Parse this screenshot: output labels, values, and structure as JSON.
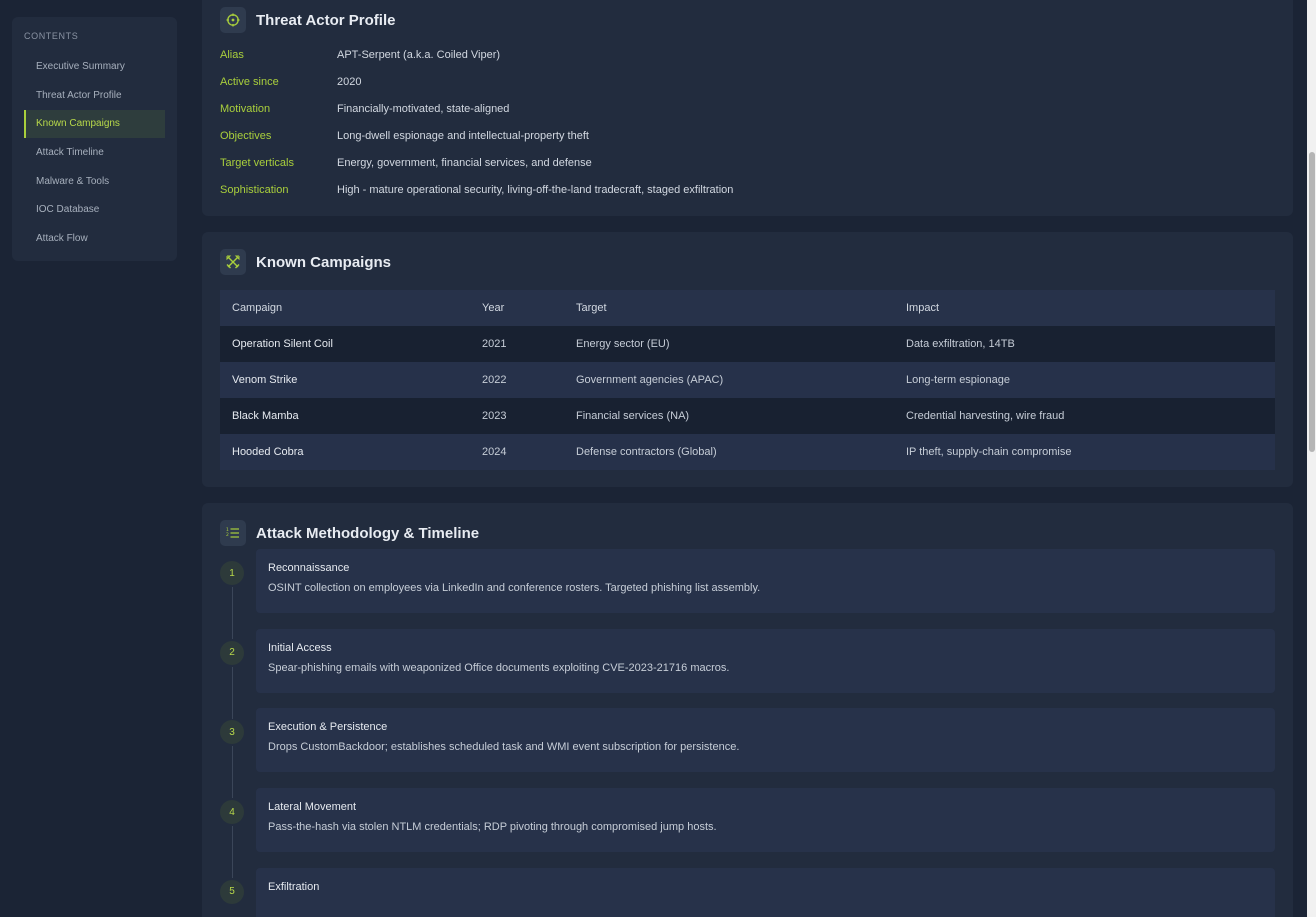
{
  "toc": {
    "heading": "CONTENTS",
    "items": [
      {
        "label": "Executive Summary"
      },
      {
        "label": "Threat Actor Profile"
      },
      {
        "label": "Known Campaigns",
        "active": true
      },
      {
        "label": "Attack Timeline"
      },
      {
        "label": "Malware & Tools"
      },
      {
        "label": "IOC Database"
      },
      {
        "label": "Attack Flow"
      }
    ]
  },
  "profile": {
    "title": "Threat Actor Profile",
    "icon": "crosshair-icon",
    "rows": [
      {
        "key": "Alias",
        "value": "APT-Serpent (a.k.a. Coiled Viper)"
      },
      {
        "key": "Active since",
        "value": "2020"
      },
      {
        "key": "Motivation",
        "value": "Financially-motivated, state-aligned"
      },
      {
        "key": "Objectives",
        "value": "Long-dwell espionage and intellectual-property theft"
      },
      {
        "key": "Target verticals",
        "value": "Energy, government, financial services, and defense"
      },
      {
        "key": "Sophistication",
        "value": "High - mature operational security, living-off-the-land tradecraft, staged exfiltration"
      }
    ]
  },
  "campaigns": {
    "title": "Known Campaigns",
    "icon": "crossed-swords-icon",
    "columns": [
      "Campaign",
      "Year",
      "Target",
      "Impact"
    ],
    "rows": [
      [
        "Operation Silent Coil",
        "2021",
        "Energy sector (EU)",
        "Data exfiltration, 14TB"
      ],
      [
        "Venom Strike",
        "2022",
        "Government agencies (APAC)",
        "Long-term espionage"
      ],
      [
        "Black Mamba",
        "2023",
        "Financial services (NA)",
        "Credential harvesting, wire fraud"
      ],
      [
        "Hooded Cobra",
        "2024",
        "Defense contractors (Global)",
        "IP theft, supply-chain compromise"
      ]
    ]
  },
  "timeline": {
    "title": "Attack Methodology & Timeline",
    "icon": "numbered-list-icon",
    "steps": [
      {
        "num": "1",
        "title": "Reconnaissance",
        "desc": "OSINT collection on employees via LinkedIn and conference rosters. Targeted phishing list assembly."
      },
      {
        "num": "2",
        "title": "Initial Access",
        "desc": "Spear-phishing emails with weaponized Office documents exploiting CVE-2023-21716 macros."
      },
      {
        "num": "3",
        "title": "Execution & Persistence",
        "desc": "Drops CustomBackdoor; establishes scheduled task and WMI event subscription for persistence."
      },
      {
        "num": "4",
        "title": "Lateral Movement",
        "desc": "Pass-the-hash via stolen NTLM credentials; RDP pivoting through compromised jump hosts."
      },
      {
        "num": "5",
        "title": "Exfiltration",
        "desc": ""
      }
    ]
  },
  "colors": {
    "accent": "#a9cf3c",
    "background": "#1b2435",
    "card": "#222c3e"
  }
}
